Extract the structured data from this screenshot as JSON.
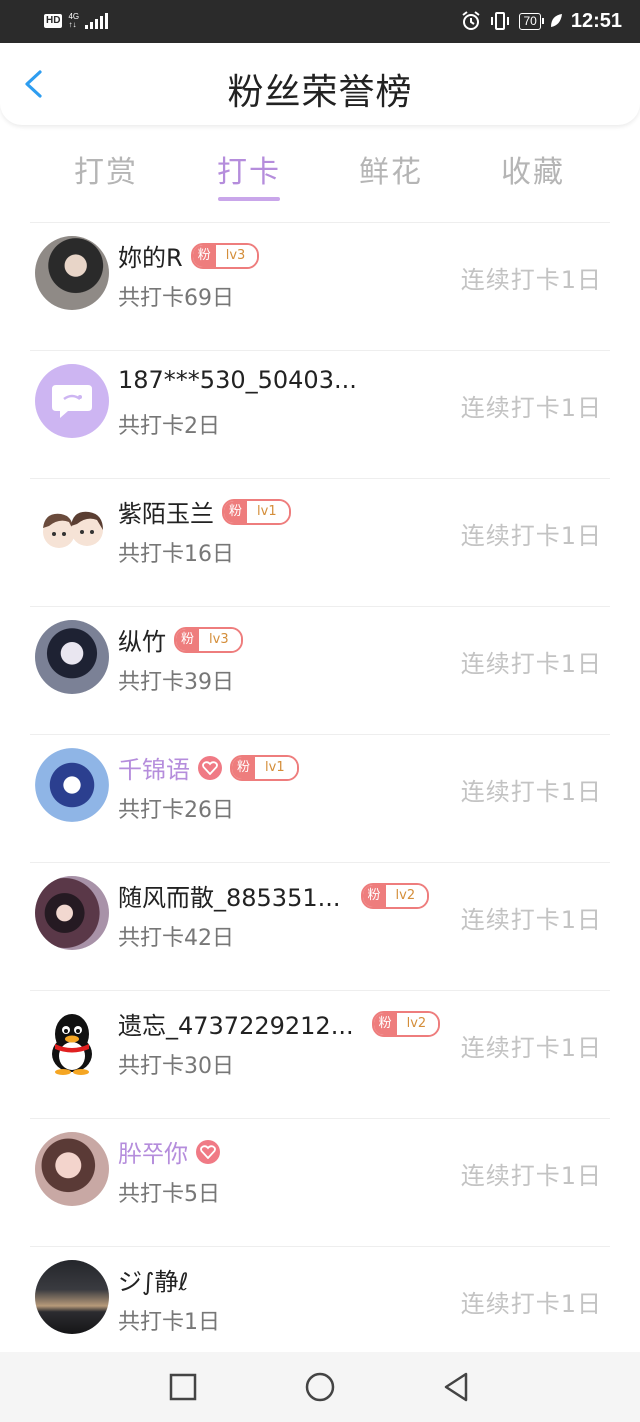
{
  "status_bar": {
    "hd": "HD",
    "net_top": "4G",
    "net_bottom": "↑↓",
    "battery": "70",
    "time": "12:51"
  },
  "header": {
    "title": "粉丝荣誉榜"
  },
  "tabs": [
    {
      "label": "打赏"
    },
    {
      "label": "打卡"
    },
    {
      "label": "鲜花"
    },
    {
      "label": "收藏"
    }
  ],
  "active_tab": "打卡",
  "rows": [
    {
      "name": "妳的R",
      "days": "共打卡69日",
      "streak": "连续打卡1日",
      "badge_left": "粉",
      "badge_right": "lv3"
    },
    {
      "name": "187***530_50403...",
      "days": "共打卡2日",
      "streak": "连续打卡1日"
    },
    {
      "name": "紫陌玉兰",
      "days": "共打卡16日",
      "streak": "连续打卡1日",
      "badge_left": "粉",
      "badge_right": "lv1"
    },
    {
      "name": "纵竹",
      "days": "共打卡39日",
      "streak": "连续打卡1日",
      "badge_left": "粉",
      "badge_right": "lv3"
    },
    {
      "name": "千锦语",
      "days": "共打卡26日",
      "streak": "连续打卡1日",
      "badge_left": "粉",
      "badge_right": "lv1"
    },
    {
      "name": "随风而散_885351...",
      "days": "共打卡42日",
      "streak": "连续打卡1日",
      "badge_left": "粉",
      "badge_right": "lv2"
    },
    {
      "name": "遗忘_4737229212...",
      "days": "共打卡30日",
      "streak": "连续打卡1日",
      "badge_left": "粉",
      "badge_right": "lv2"
    },
    {
      "name": "肸쭈你",
      "days": "共打卡5日",
      "streak": "连续打卡1日"
    },
    {
      "name": "ジ∫静ℓ",
      "days": "共打卡1日",
      "streak": "连续打卡1日"
    }
  ],
  "colors": {
    "accent": "#b58ddc",
    "badge": "#ee7d7d",
    "muted": "#c3c3c3"
  }
}
